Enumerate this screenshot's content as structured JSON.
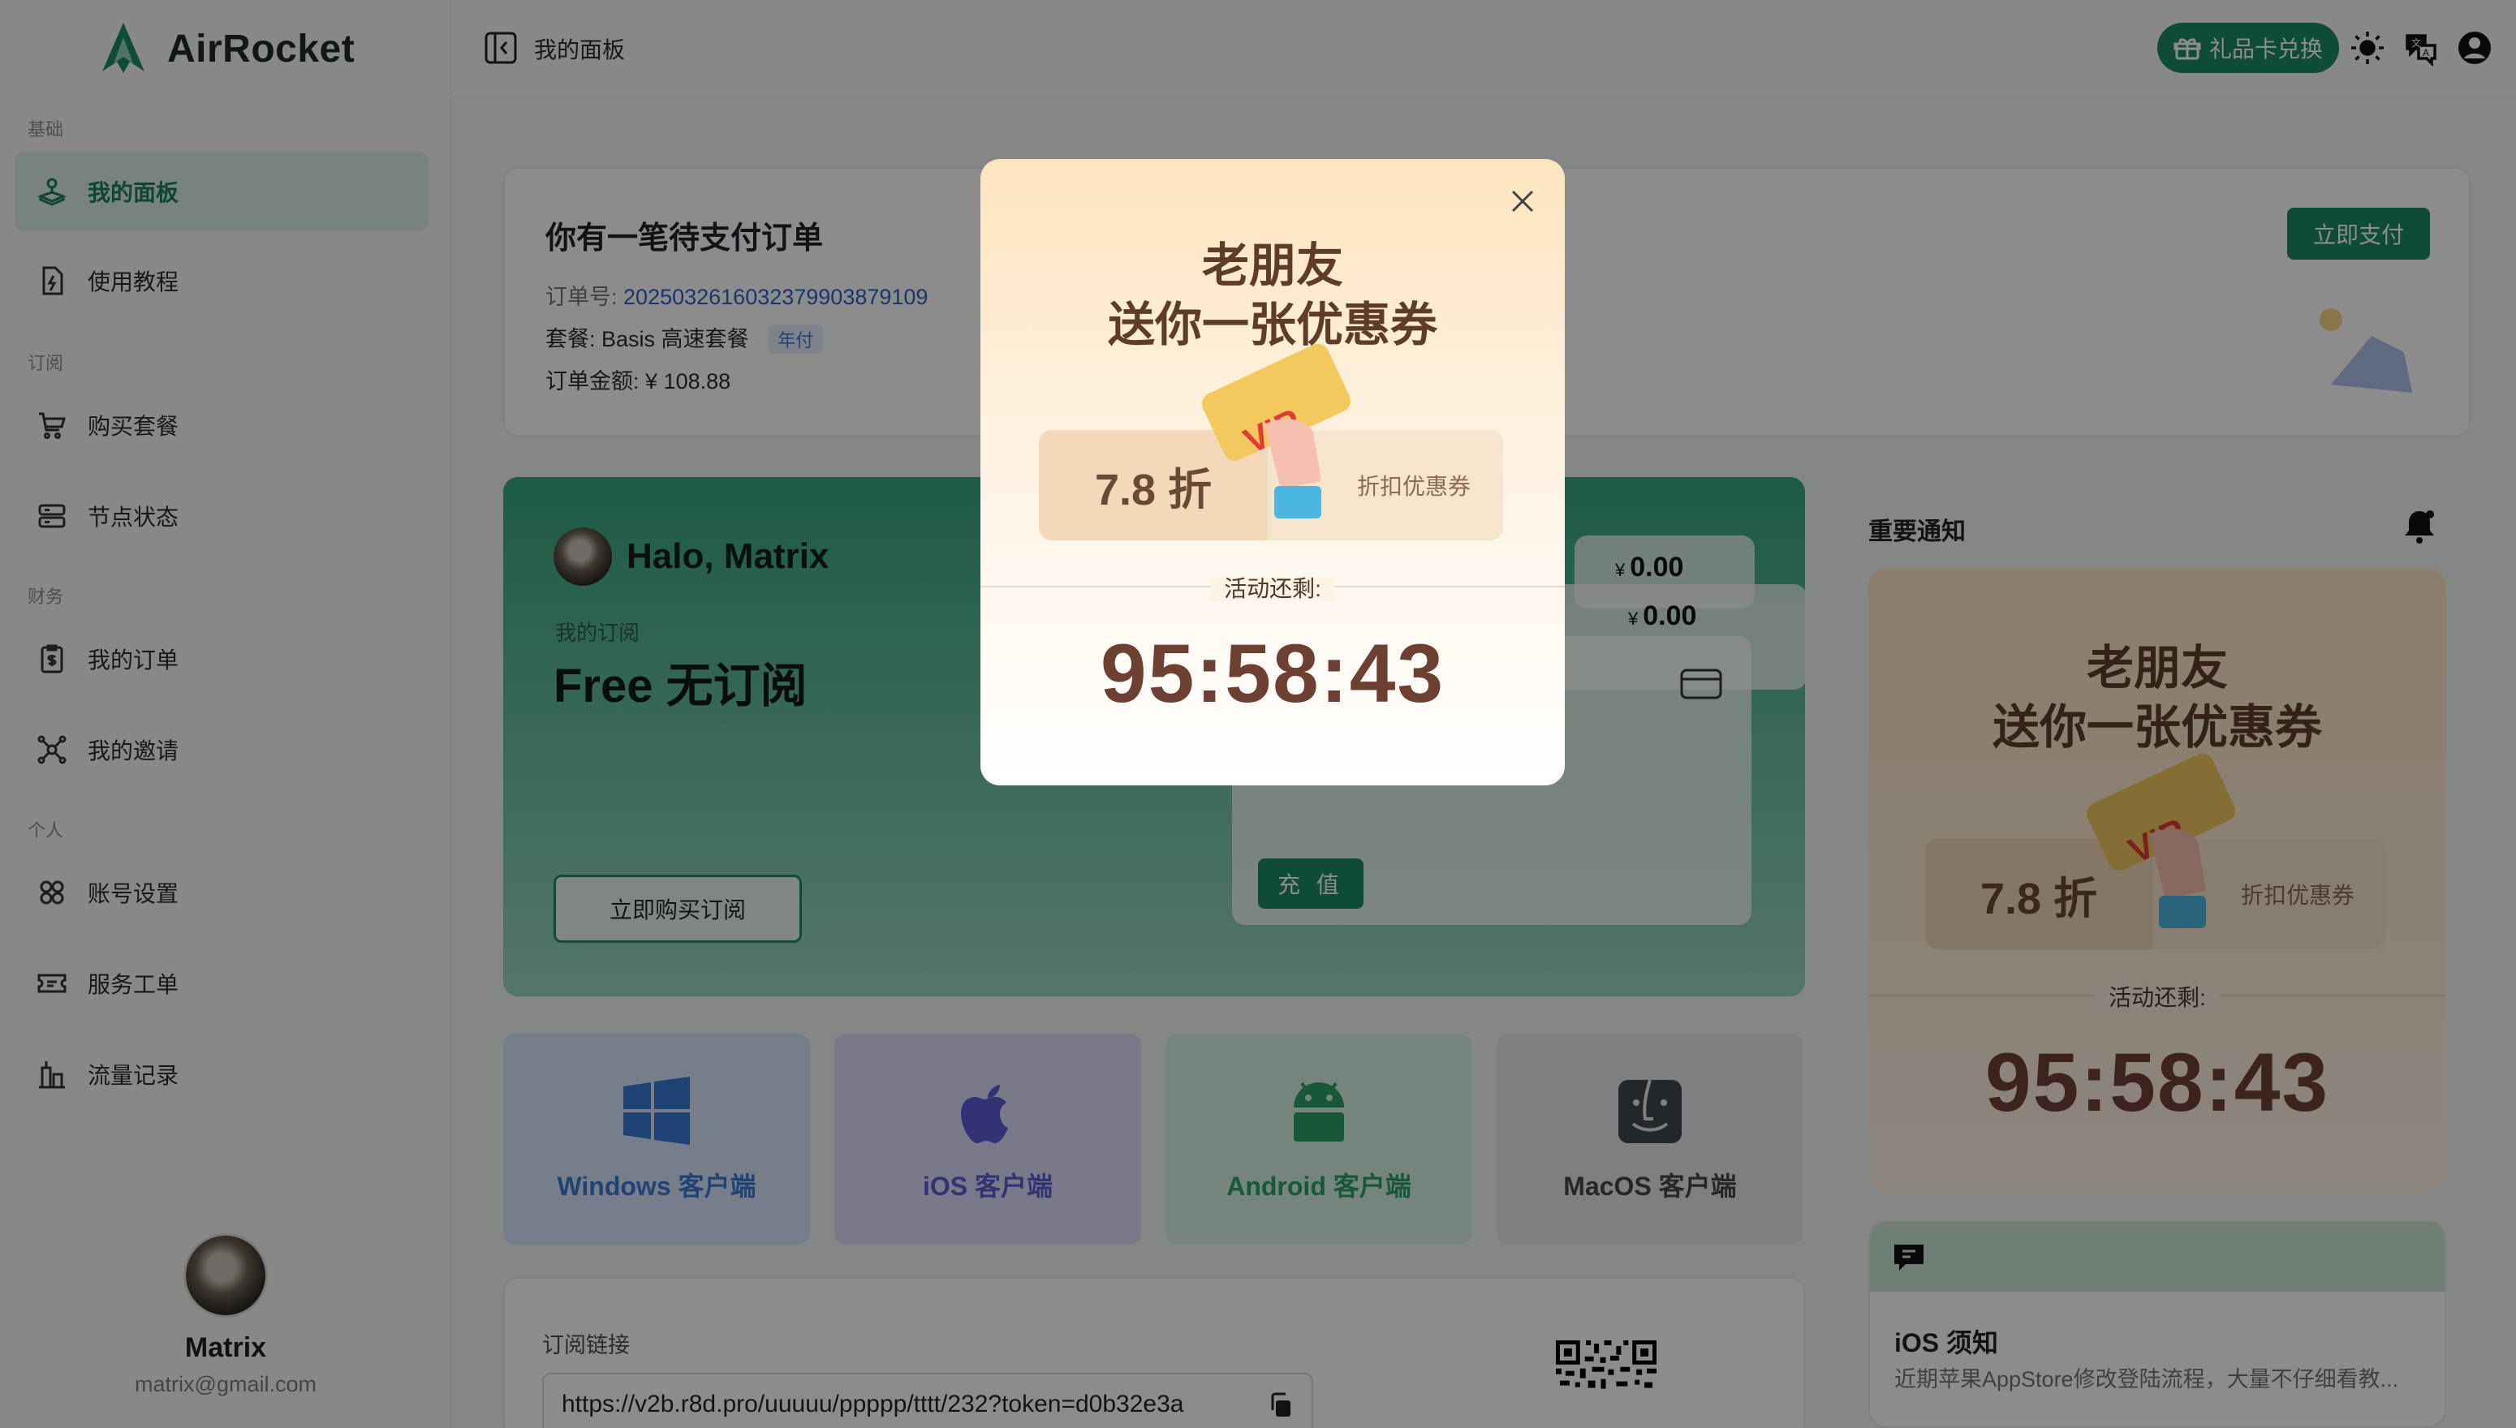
{
  "app": {
    "name": "AirRocket"
  },
  "sidebar": {
    "groups": [
      {
        "label": "基础"
      },
      {
        "label": "订阅"
      },
      {
        "label": "财务"
      },
      {
        "label": "个人"
      }
    ],
    "items": [
      {
        "label": "我的面板",
        "icon": "joystick-icon",
        "active": true
      },
      {
        "label": "使用教程",
        "icon": "document-bolt-icon"
      },
      {
        "label": "购买套餐",
        "icon": "cart-icon"
      },
      {
        "label": "节点状态",
        "icon": "server-icon"
      },
      {
        "label": "我的订单",
        "icon": "receipt-icon"
      },
      {
        "label": "我的邀请",
        "icon": "invite-icon"
      },
      {
        "label": "账号设置",
        "icon": "user-settings-icon"
      },
      {
        "label": "服务工单",
        "icon": "ticket-icon"
      },
      {
        "label": "流量记录",
        "icon": "building-chart-icon"
      }
    ],
    "user": {
      "name": "Matrix",
      "email": "matrix@gmail.com"
    }
  },
  "topbar": {
    "title": "我的面板",
    "gift_label": "礼品卡兑换",
    "icons": [
      "sun-icon",
      "language-icon",
      "user-circle-icon"
    ]
  },
  "order": {
    "title": "你有一笔待支付订单",
    "order_no_label": "订单号:",
    "order_no": "2025032616032379903879109",
    "plan_label": "套餐:",
    "plan_name": "Basis 高速套餐",
    "period_tag": "年付",
    "amount_label": "订单金额:",
    "amount": "¥ 108.88",
    "pay_label": "立即支付"
  },
  "subscription": {
    "greeting": "Halo, Matrix",
    "my_sub_label": "我的订阅",
    "plan": "Free 无订阅",
    "buy_label": "立即购买订阅",
    "currency": "¥",
    "wallet_back": "0.00",
    "wallet_front": "0.00",
    "recharge_label": "充 值"
  },
  "clients": [
    {
      "label": "Windows 客户端",
      "icon": "windows-icon"
    },
    {
      "label": "iOS 客户端",
      "icon": "apple-icon"
    },
    {
      "label": "Android 客户端",
      "icon": "android-icon"
    },
    {
      "label": "MacOS 客户端",
      "icon": "finder-icon"
    }
  ],
  "sub_link": {
    "label": "订阅链接",
    "url": "https://v2b.r8d.pro/uuuuu/ppppp/tttt/232?token=d0b32e3a"
  },
  "notices": {
    "title": "重要通知",
    "ios": {
      "title": "iOS 须知",
      "desc": "近期苹果AppStore修改登陆流程，大量不仔细看教..."
    }
  },
  "promo": {
    "title_line1": "老朋友",
    "title_line2": "送你一张优惠券",
    "discount": "7.8 折",
    "coupon_type": "折扣优惠券",
    "remain_label": "活动还剩:",
    "countdown": "95:58:43",
    "badge": "VIP"
  },
  "colors": {
    "brand": "#1c8a66",
    "promo_text": "#6e4032",
    "windows": "#3a7bd5",
    "ios": "#5b5bd6",
    "android": "#2aa06a",
    "macos": "#444a4e"
  }
}
